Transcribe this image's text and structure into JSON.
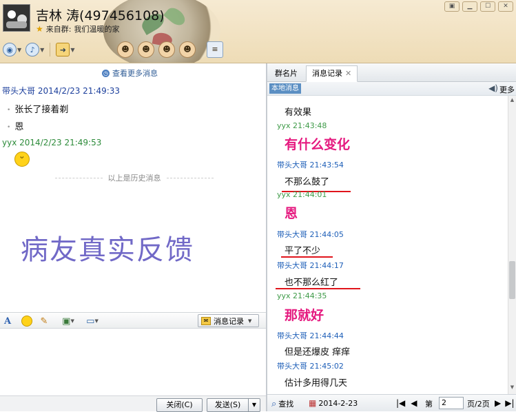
{
  "header": {
    "contact_name": "吉林 涛(497456108)",
    "source_label": "来自群:",
    "source_group": "我们温暖的家",
    "window_buttons": [
      "▣",
      "▁",
      "☐",
      "✕"
    ]
  },
  "chat": {
    "view_more": "查看更多消息",
    "messages": [
      {
        "sender": "带头大哥 2014/2/23 21:49:33",
        "lines": [
          "张长了接着剃",
          "恩"
        ]
      },
      {
        "sender": "yyx 2014/2/23 21:49:53",
        "emoji": "grin-emoji"
      }
    ],
    "history_divider": "以上是历史消息",
    "watermark": "病友真实反馈"
  },
  "editbar": {
    "font_icon": "A",
    "msg_log_button": "消息记录"
  },
  "bottom": {
    "close_button": "关闭(C)",
    "send_button": "发送(S)"
  },
  "right_panel": {
    "tabs": [
      "群名片",
      "消息记录"
    ],
    "local_label": "本地消息",
    "more_label": "更多",
    "log": [
      {
        "type": "text",
        "text": "有效果"
      },
      {
        "type": "sender",
        "text": "yyx 21:43:48"
      },
      {
        "type": "big",
        "text": "有什么变化"
      },
      {
        "type": "sender",
        "text": "带头大哥 21:43:54"
      },
      {
        "type": "text",
        "text": "不那么鼓了"
      },
      {
        "type": "sender",
        "text": "yyx 21:44:01"
      },
      {
        "type": "big",
        "text": "恩"
      },
      {
        "type": "sender",
        "text": "带头大哥 21:44:05"
      },
      {
        "type": "text",
        "text": "平了不少"
      },
      {
        "type": "sender",
        "text": "带头大哥 21:44:17"
      },
      {
        "type": "text",
        "text": "也不那么红了"
      },
      {
        "type": "sender",
        "text": "yyx 21:44:35"
      },
      {
        "type": "big",
        "text": "那就好"
      },
      {
        "type": "sender",
        "text": "带头大哥 21:44:44"
      },
      {
        "type": "text",
        "text": "但是还爆皮 痒痒"
      },
      {
        "type": "sender",
        "text": "带头大哥 21:45:02"
      },
      {
        "type": "text",
        "text": "估计多用得几天"
      }
    ],
    "search_label": "查找",
    "date_value": "2014-2-23",
    "page_prefix": "第",
    "page_value": "2",
    "page_suffix": "页/2页"
  },
  "colors": {
    "accent_pink": "#e5197f",
    "underline_red": "#e0141b",
    "sender_blue": "#1e5fb8",
    "sender_green": "#3d9a47"
  }
}
